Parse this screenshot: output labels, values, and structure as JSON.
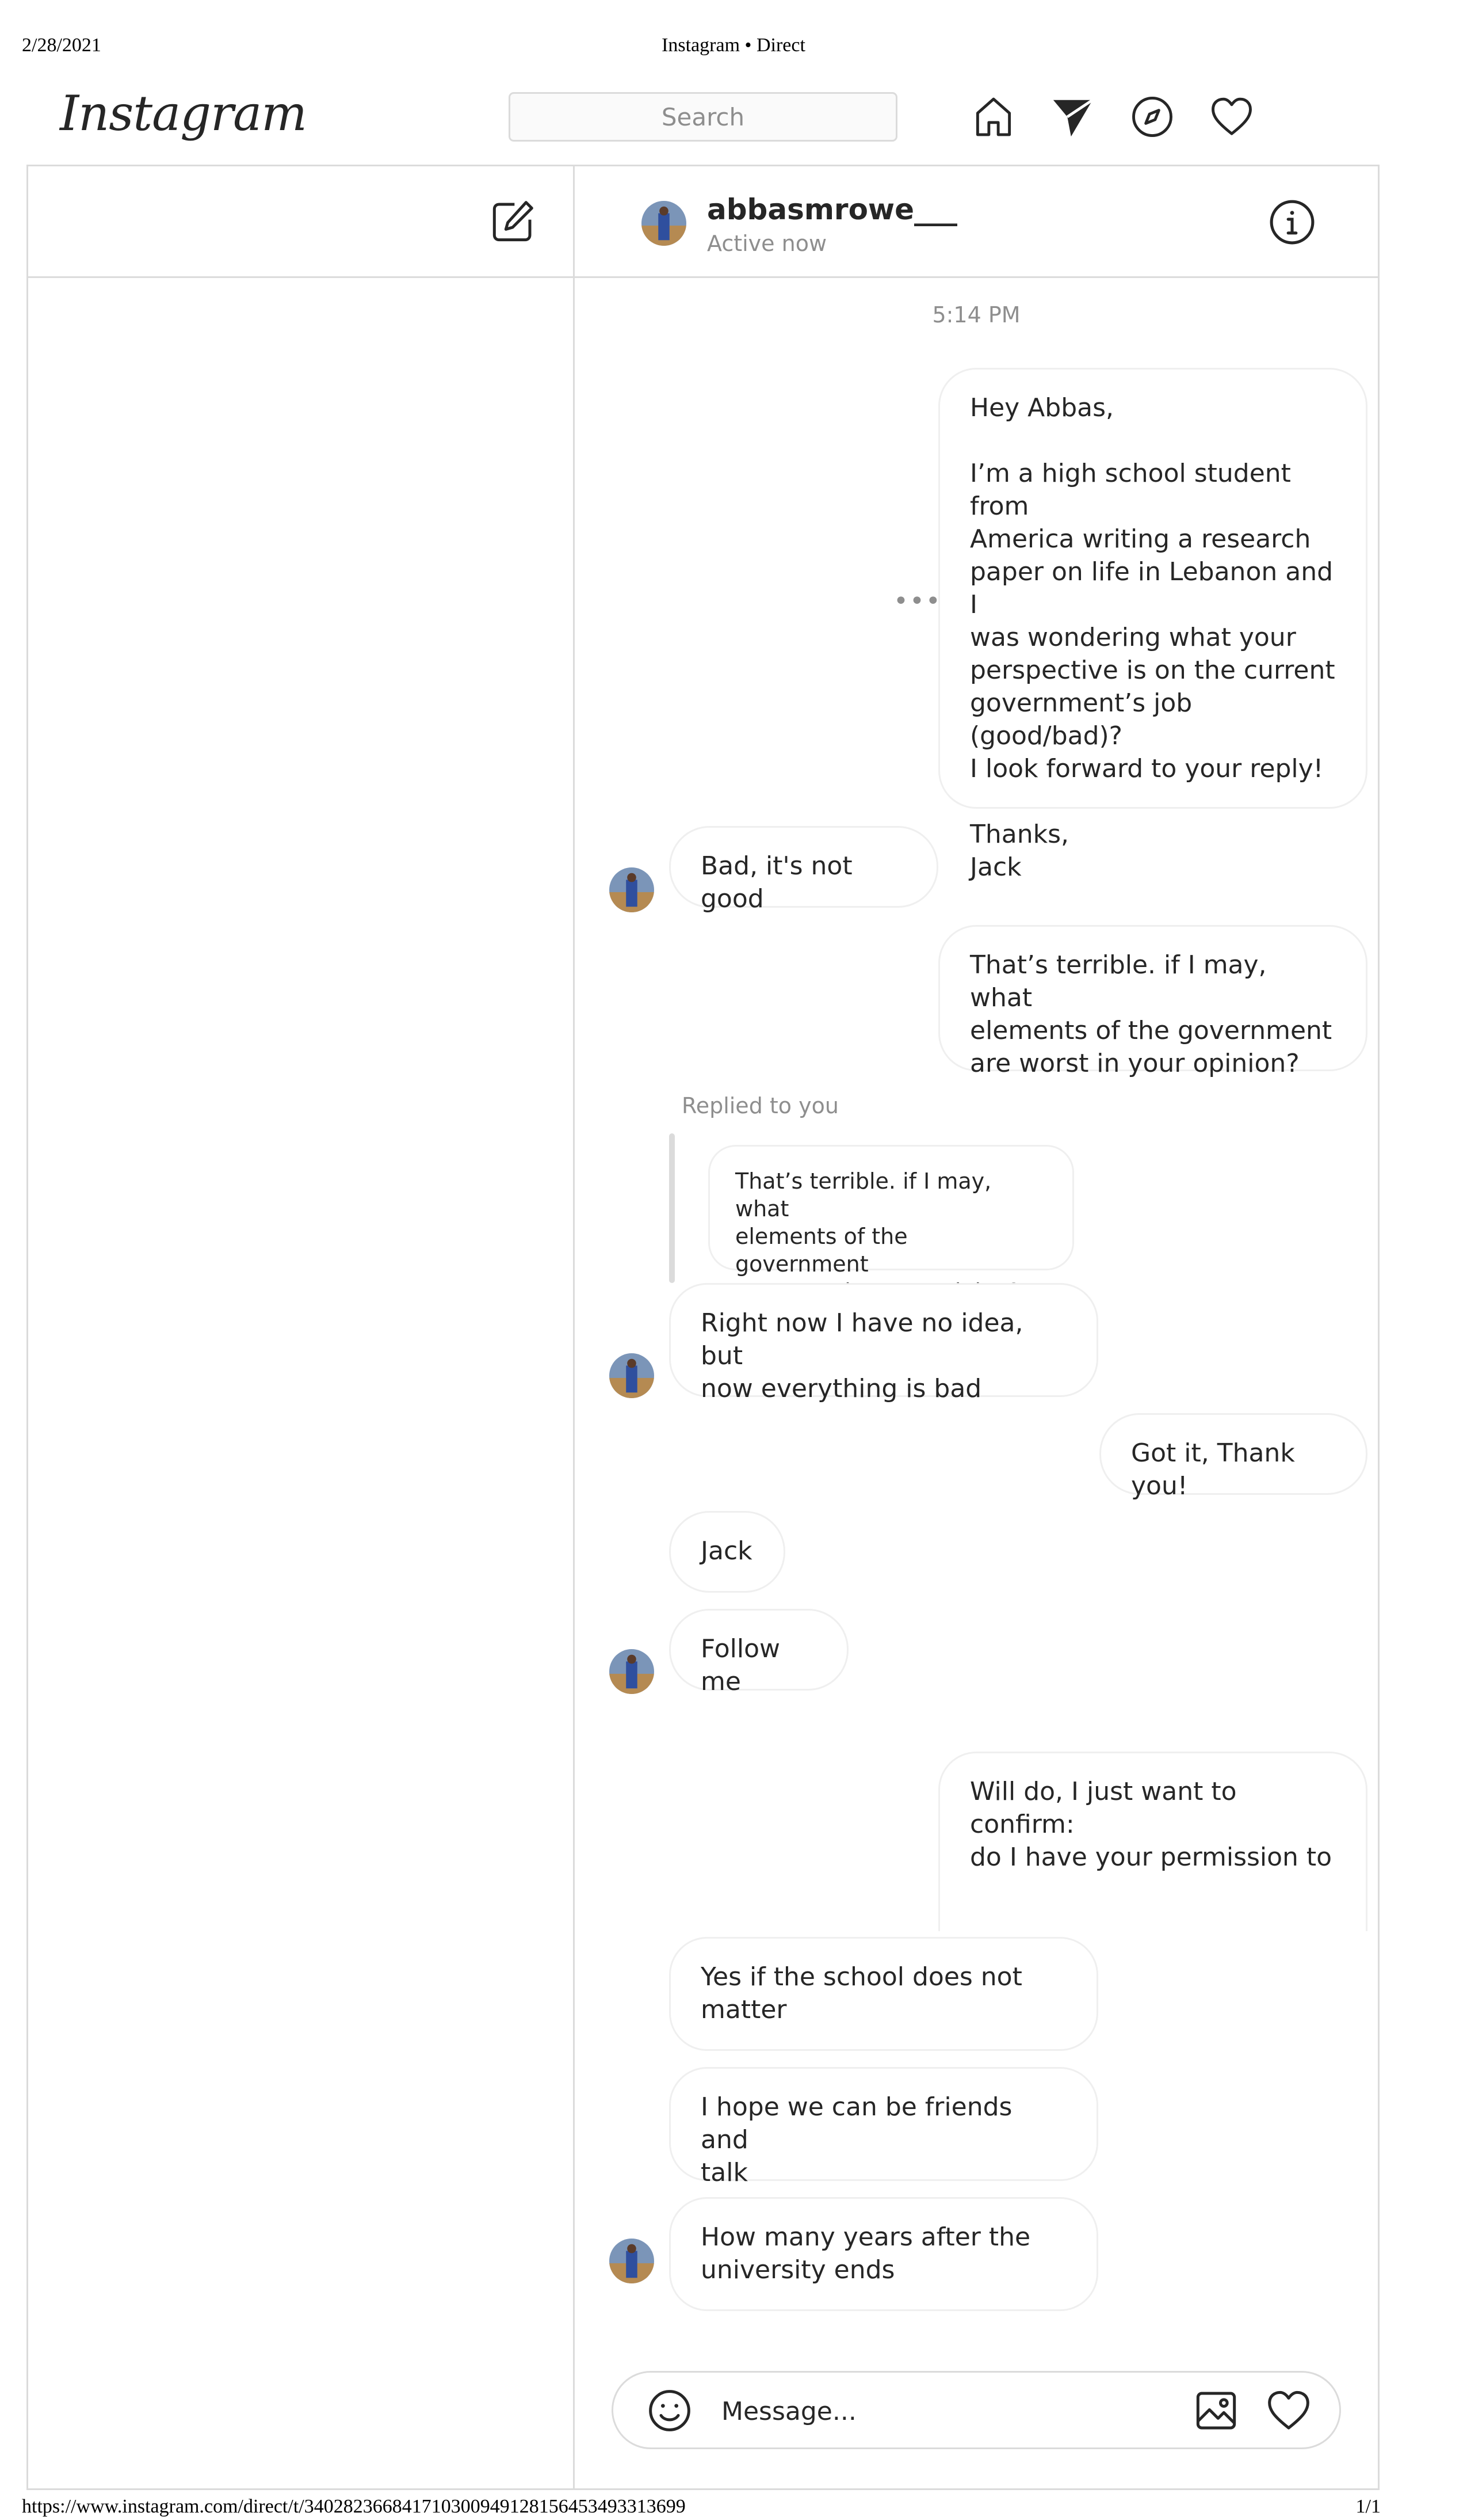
{
  "print_header": {
    "date": "2/28/2021",
    "title": "Instagram • Direct"
  },
  "print_footer": {
    "url": "https://www.instagram.com/direct/t/340282366841710300949128156453493313699",
    "page": "1/1"
  },
  "nav": {
    "logo": "Instagram",
    "search_placeholder": "Search",
    "icons": [
      "home-icon",
      "direct-paper-plane-icon",
      "explore-compass-icon",
      "activity-heart-icon"
    ]
  },
  "sidebar": {
    "compose_icon": "new-message-icon"
  },
  "chat": {
    "username": "abbasmrowe___",
    "status": "Active now",
    "info_icon": "info-icon",
    "timestamp": "5:14 PM",
    "reply_label": "Replied to you",
    "quoted_text": "That’s terrible. if I may, what\nelements of the government\nare worst in your opinion?",
    "messages": [
      {
        "from": "me",
        "text": "Hey Abbas,\n\nI’m a high school student from\nAmerica writing a research\npaper on life in Lebanon and I\nwas wondering what your\nperspective is on the current\ngovernment’s job (good/bad)?\nI look forward to your reply!\n\nThanks,\nJack"
      },
      {
        "from": "them",
        "text": "Bad, it's not good"
      },
      {
        "from": "me",
        "text": "That’s terrible. if I may, what\nelements of the government\nare worst in your opinion?"
      },
      {
        "from": "them",
        "text": "Right now I have no idea, but\nnow everything is bad"
      },
      {
        "from": "me",
        "text": "Got it, Thank you!"
      },
      {
        "from": "them",
        "text": "Jack"
      },
      {
        "from": "them",
        "text": "Follow me"
      },
      {
        "from": "me",
        "text": "Will do, I just want to confirm:\ndo I have your permission to\n\n\nuse your name in my school"
      },
      {
        "from": "them",
        "text": "Yes if the school does not\nmatter"
      },
      {
        "from": "them",
        "text": "I hope we can be friends and\ntalk"
      },
      {
        "from": "them",
        "text": "How many years after the\nuniversity ends"
      }
    ]
  },
  "composer": {
    "placeholder": "Message...",
    "icons": [
      "emoji-icon",
      "image-icon",
      "heart-icon"
    ]
  },
  "colors": {
    "border": "#dbdbdb",
    "bubble_border": "#efefef",
    "text": "#262626",
    "muted": "#8e8e8e"
  }
}
